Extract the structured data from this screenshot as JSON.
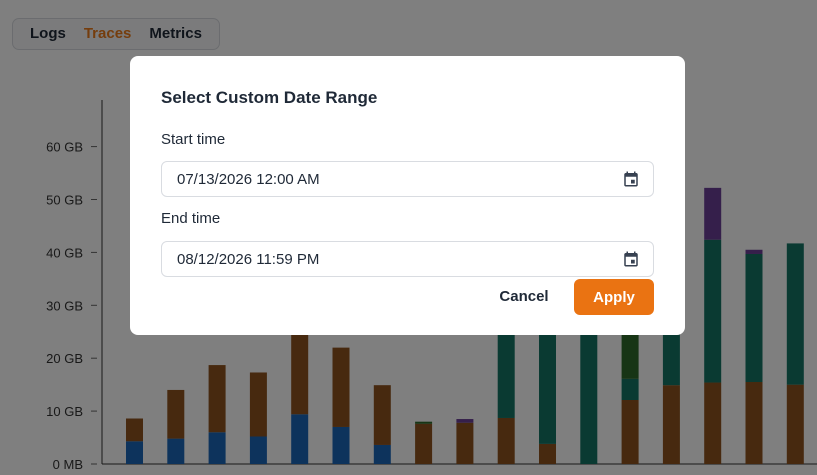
{
  "tabs": [
    {
      "label": "Logs",
      "active": false
    },
    {
      "label": "Traces",
      "active": true
    },
    {
      "label": "Metrics",
      "active": false
    }
  ],
  "modal": {
    "title": "Select Custom Date Range",
    "start_label": "Start time",
    "start_value": "07/13/2026 12:00 AM",
    "end_label": "End time",
    "end_value": "08/12/2026 11:59 PM",
    "cancel_label": "Cancel",
    "apply_label": "Apply"
  },
  "colors": {
    "accent": "#ea7312",
    "series": [
      "#1a66b8",
      "#8e531e",
      "#147565",
      "#2f6a2a",
      "#6a3f97"
    ]
  },
  "icons": {
    "date_picker": "calendar-icon"
  },
  "chart_data": {
    "type": "bar",
    "stacked": true,
    "ytick_labels": [
      "0 MB",
      "10 GB",
      "20 GB",
      "30 GB",
      "40 GB",
      "50 GB",
      "60 GB"
    ],
    "ylim": [
      0,
      68
    ],
    "bars": [
      [
        4.3,
        4.3,
        0,
        0,
        0
      ],
      [
        4.8,
        9.2,
        0,
        0,
        0
      ],
      [
        6.0,
        12.7,
        0,
        0,
        0
      ],
      [
        5.2,
        12.1,
        0,
        0,
        0
      ],
      [
        9.4,
        15.0,
        0,
        0,
        0
      ],
      [
        7.0,
        15.0,
        0,
        0,
        0
      ],
      [
        3.6,
        11.3,
        0,
        0,
        0
      ],
      [
        0,
        7.6,
        0,
        0.4,
        0
      ],
      [
        0,
        7.8,
        0,
        0,
        0.7
      ],
      [
        0,
        8.7,
        16.0,
        0,
        0
      ],
      [
        0,
        3.8,
        21.0,
        0,
        0
      ],
      [
        0,
        0,
        25.0,
        0,
        0
      ],
      [
        0,
        12.1,
        4.0,
        8.3,
        0
      ],
      [
        0,
        14.9,
        10.0,
        0,
        0
      ],
      [
        0,
        15.4,
        27.0,
        0,
        9.8
      ],
      [
        0,
        15.5,
        24.2,
        0,
        0.8
      ],
      [
        0,
        15.0,
        26.7,
        0,
        0
      ]
    ]
  }
}
